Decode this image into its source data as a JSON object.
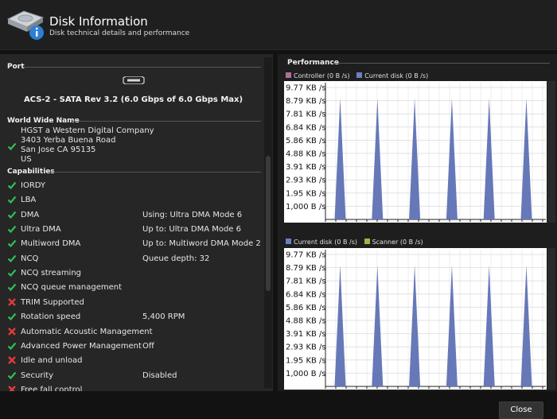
{
  "header": {
    "title": "Disk Information",
    "subtitle": "Disk technical details and performance"
  },
  "port": {
    "section_title": "Port",
    "description": "ACS-2 - SATA Rev 3.2 (6.0 Gbps of 6.0 Gbps Max)"
  },
  "wwn": {
    "section_title": "World Wide Name",
    "lines": [
      "HGST a Western Digital Company",
      "3403 Yerba Buena Road",
      "San Jose  CA  95135",
      "US"
    ]
  },
  "capabilities": {
    "section_title": "Capabilities",
    "items": [
      {
        "label": "IORDY",
        "value": "",
        "status": "ok"
      },
      {
        "label": "LBA",
        "value": "",
        "status": "ok"
      },
      {
        "label": "DMA",
        "value": "Using: Ultra DMA Mode 6",
        "status": "ok"
      },
      {
        "label": "Ultra DMA",
        "value": "Up to: Ultra DMA Mode 6",
        "status": "ok"
      },
      {
        "label": "Multiword DMA",
        "value": "Up to: Multiword DMA Mode 2",
        "status": "ok"
      },
      {
        "label": "NCQ",
        "value": "Queue depth: 32",
        "status": "ok"
      },
      {
        "label": "NCQ streaming",
        "value": "",
        "status": "ok"
      },
      {
        "label": "NCQ queue management",
        "value": "",
        "status": "ok"
      },
      {
        "label": "TRIM Supported",
        "value": "",
        "status": "no"
      },
      {
        "label": "Rotation speed",
        "value": "5,400 RPM",
        "status": "ok"
      },
      {
        "label": "Automatic Acoustic Management",
        "value": "",
        "status": "no"
      },
      {
        "label": "Advanced Power Management",
        "value": "Off",
        "status": "ok"
      },
      {
        "label": "Idle and unload",
        "value": "",
        "status": "no"
      },
      {
        "label": "Security",
        "value": "Disabled",
        "status": "ok"
      },
      {
        "label": "Free fall control",
        "value": "",
        "status": "no"
      }
    ]
  },
  "performance": {
    "section_title": "Performance"
  },
  "colors": {
    "ok": "#2fbf57",
    "no": "#e03b3b",
    "controller": "#b06f9a",
    "current_disk": "#6b7fc4",
    "scanner": "#a8b04a",
    "area_fill": "#6678b8"
  },
  "chart_data": [
    {
      "type": "area",
      "legend": [
        {
          "name": "Controller (0 B /s)",
          "color": "#b06f9a"
        },
        {
          "name": "Current disk (0 B /s)",
          "color": "#6b7fc4"
        }
      ],
      "yticks": [
        "9.77 KB /s",
        "8.79 KB /s",
        "7.81 KB /s",
        "6.84 KB /s",
        "5.86 KB /s",
        "4.88 KB /s",
        "3.91 KB /s",
        "2.93 KB /s",
        "1.95 KB /s",
        "1,000 B /s"
      ],
      "ylim": [
        0,
        10000
      ],
      "legend_position": "top-left",
      "grid": true,
      "spikes": [
        9000,
        9000,
        9000,
        9000,
        9000,
        9000
      ]
    },
    {
      "type": "area",
      "legend": [
        {
          "name": "Current disk (0 B /s)",
          "color": "#6b7fc4"
        },
        {
          "name": "Scanner (0 B /s)",
          "color": "#a8b04a"
        }
      ],
      "yticks": [
        "9.77 KB /s",
        "8.79 KB /s",
        "7.81 KB /s",
        "6.84 KB /s",
        "5.86 KB /s",
        "4.88 KB /s",
        "3.91 KB /s",
        "2.93 KB /s",
        "1.95 KB /s",
        "1,000 B /s"
      ],
      "ylim": [
        0,
        10000
      ],
      "legend_position": "top-left",
      "grid": true,
      "spikes": [
        9000,
        9000,
        9000,
        9000,
        9000,
        9000
      ]
    }
  ],
  "footer": {
    "close_label": "Close"
  }
}
